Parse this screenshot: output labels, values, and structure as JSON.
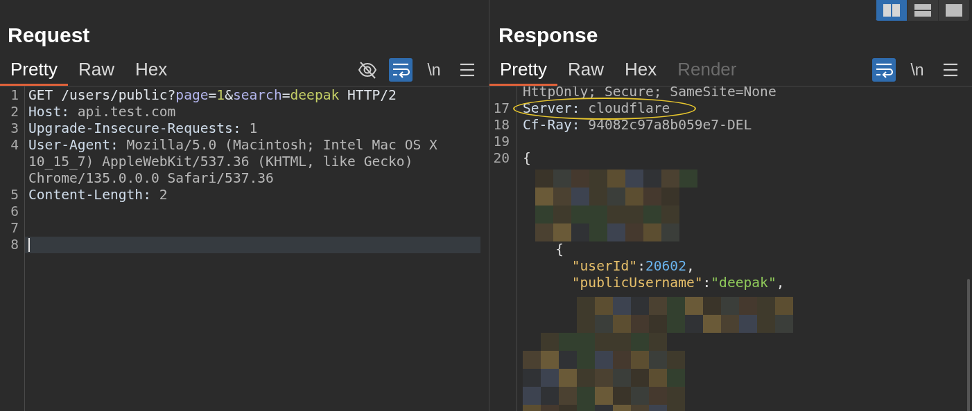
{
  "layout_buttons": [
    {
      "kind": "side-by-side",
      "selected": true
    },
    {
      "kind": "stacked",
      "selected": false
    },
    {
      "kind": "single",
      "selected": false
    }
  ],
  "request": {
    "title": "Request",
    "tabs": [
      {
        "label": "Pretty",
        "selected": true,
        "disabled": false
      },
      {
        "label": "Raw",
        "selected": false,
        "disabled": false
      },
      {
        "label": "Hex",
        "selected": false,
        "disabled": false
      }
    ],
    "toolbar": [
      {
        "kind": "hide",
        "active": false
      },
      {
        "kind": "wrap",
        "active": true
      },
      {
        "kind": "newline",
        "label": "\\n",
        "active": false
      },
      {
        "kind": "menu",
        "active": false
      }
    ],
    "lines": [
      {
        "number": "1",
        "current": false,
        "segments": [
          {
            "text": "GET /users/public?",
            "kind": "plain"
          },
          {
            "text": "page",
            "kind": "param"
          },
          {
            "text": "=",
            "kind": "plain"
          },
          {
            "text": "1",
            "kind": "param_value"
          },
          {
            "text": "&",
            "kind": "plain"
          },
          {
            "text": "search",
            "kind": "param"
          },
          {
            "text": "=",
            "kind": "plain"
          },
          {
            "text": "deepak",
            "kind": "param_value"
          },
          {
            "text": " HTTP/2",
            "kind": "plain"
          }
        ]
      },
      {
        "number": "2",
        "current": false,
        "segments": [
          {
            "text": "Host:",
            "kind": "header"
          },
          {
            "text": " api.test.com",
            "kind": "header_value"
          }
        ]
      },
      {
        "number": "3",
        "current": false,
        "segments": [
          {
            "text": "Upgrade-Insecure-Requests:",
            "kind": "header"
          },
          {
            "text": " 1",
            "kind": "header_value"
          }
        ]
      },
      {
        "number": "4",
        "current": false,
        "segments": [
          {
            "text": "User-Agent:",
            "kind": "header"
          },
          {
            "text": " Mozilla/5.0 (Macintosh; Intel Mac OS X 10_15_7) AppleWebKit/537.36 (KHTML, like Gecko) Chrome/135.0.0.0 Safari/537.36",
            "kind": "header_value"
          }
        ]
      },
      {
        "number": "5",
        "current": false,
        "segments": [
          {
            "text": "Content-Length:",
            "kind": "header"
          },
          {
            "text": " 2",
            "kind": "header_value"
          }
        ]
      },
      {
        "number": "6",
        "current": false
      },
      {
        "number": "7",
        "current": false
      },
      {
        "number": "8",
        "current": true
      }
    ]
  },
  "response": {
    "title": "Response",
    "tabs": [
      {
        "label": "Pretty",
        "selected": true,
        "disabled": false
      },
      {
        "label": "Raw",
        "selected": false,
        "disabled": false
      },
      {
        "label": "Hex",
        "selected": false,
        "disabled": false
      },
      {
        "label": "Render",
        "selected": false,
        "disabled": true
      }
    ],
    "toolbar": [
      {
        "kind": "wrap",
        "active": true
      },
      {
        "kind": "newline",
        "label": "\\n",
        "active": false
      },
      {
        "kind": "menu",
        "active": false
      }
    ],
    "lines": [
      {
        "kind": "text",
        "circled": false,
        "segments": [
          {
            "text": "HttpOnly; Secure; SameSite=None",
            "kind": "header_value"
          }
        ]
      },
      {
        "kind": "text",
        "number": "17",
        "circled": true,
        "segments": [
          {
            "text": "Server:",
            "kind": "header"
          },
          {
            "text": " cloudflare",
            "kind": "header_value"
          }
        ]
      },
      {
        "kind": "text",
        "number": "18",
        "circled": false,
        "segments": [
          {
            "text": "Cf-Ray:",
            "kind": "header"
          },
          {
            "text": " 94082c97a8b059e7-DEL",
            "kind": "header_value"
          }
        ]
      },
      {
        "kind": "text",
        "number": "19",
        "circled": false
      },
      {
        "kind": "text",
        "number": "20",
        "circled": false,
        "segments": [
          {
            "text": "{",
            "kind": "punct"
          }
        ]
      },
      {
        "kind": "redacted"
      },
      {
        "kind": "text",
        "circled": false,
        "segments": [
          {
            "text": "    {",
            "kind": "punct"
          }
        ]
      },
      {
        "kind": "text",
        "circled": false,
        "segments": [
          {
            "text": "      \"userId\"",
            "kind": "key"
          },
          {
            "text": ":",
            "kind": "punct"
          },
          {
            "text": "20602",
            "kind": "number"
          },
          {
            "text": ",",
            "kind": "punct"
          }
        ]
      },
      {
        "kind": "text",
        "circled": false,
        "segments": [
          {
            "text": "      \"publicUsername\"",
            "kind": "key"
          },
          {
            "text": ":",
            "kind": "punct"
          },
          {
            "text": "\"deepak\"",
            "kind": "string"
          },
          {
            "text": ",",
            "kind": "punct"
          }
        ]
      },
      {
        "kind": "redacted"
      }
    ]
  }
}
